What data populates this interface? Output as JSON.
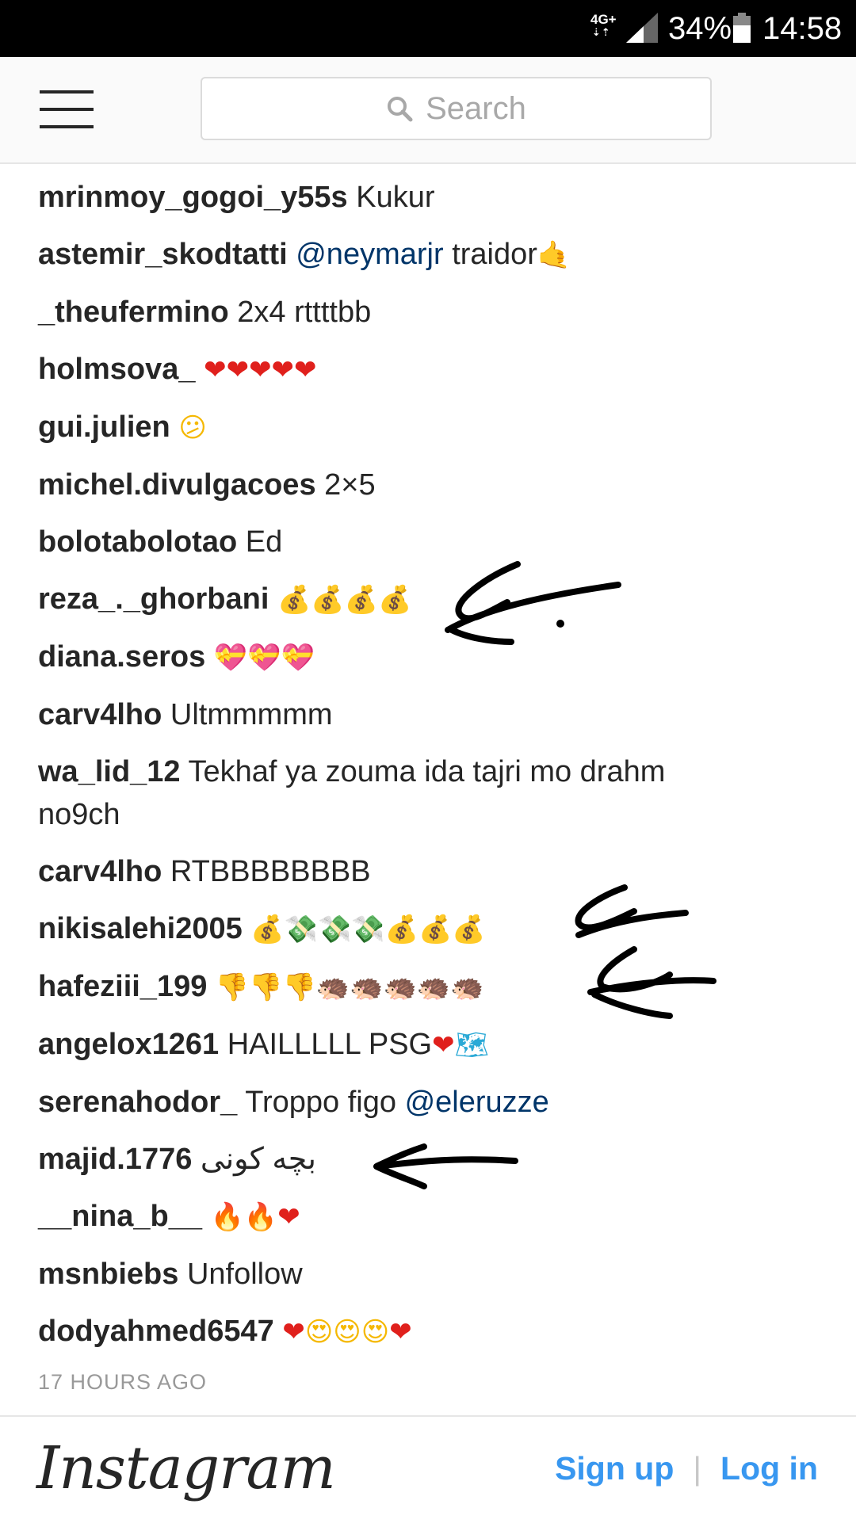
{
  "status_bar": {
    "network": "4G+",
    "battery": "34%",
    "time": "14:58"
  },
  "header": {
    "search_placeholder": "Search"
  },
  "comments": [
    {
      "user": "mrinmoy_gogoi_y55s",
      "text": "Kukur"
    },
    {
      "user": "astemir_skodtatti",
      "mention": "@neymarjr",
      "text": "traidor",
      "emojis": [
        "call-me-hand"
      ]
    },
    {
      "user": "_theufermino",
      "text": "2x4 rttttbb"
    },
    {
      "user": "holmsova_",
      "emojis": [
        "heart",
        "heart",
        "heart",
        "heart",
        "heart"
      ]
    },
    {
      "user": "gui.julien",
      "emojis": [
        "confused-face"
      ]
    },
    {
      "user": "michel.divulgacoes",
      "text": "2×5"
    },
    {
      "user": "bolotabolotao",
      "text": "Ed"
    },
    {
      "user": "reza_._ghorbani",
      "emojis": [
        "money-bag",
        "money-bag",
        "money-bag",
        "money-bag"
      ]
    },
    {
      "user": "diana.seros",
      "emojis": [
        "heart-ribbon",
        "heart-ribbon",
        "heart-ribbon"
      ]
    },
    {
      "user": "carv4lho",
      "text": "Ultmmmmm"
    },
    {
      "user": "wa_lid_12",
      "text": "Tekhaf ya zouma ida tajri mo drahm no9ch"
    },
    {
      "user": "carv4lho",
      "text": "RTBBBBBBBB"
    },
    {
      "user": "nikisalehi2005",
      "emojis": [
        "money-bag",
        "money-wings",
        "money-wings",
        "money-wings",
        "money-bag",
        "money-bag",
        "money-bag"
      ]
    },
    {
      "user": "hafeziii_199",
      "emojis": [
        "thumbs-down",
        "thumbs-down",
        "thumbs-down",
        "hedgehog",
        "hedgehog",
        "hedgehog",
        "hedgehog",
        "hedgehog"
      ]
    },
    {
      "user": "angelox1261",
      "text": "HAILLLLL PSG",
      "emojis": [
        "heart",
        "world-map"
      ]
    },
    {
      "user": "serenahodor_",
      "text": "Troppo figo",
      "mention": "@eleruzze"
    },
    {
      "user": "majid.1776",
      "text": "بچه کونی"
    },
    {
      "user": "__nina_b__",
      "emojis": [
        "fire",
        "fire",
        "heart"
      ]
    },
    {
      "user": "msnbiebs",
      "text": "Unfollow"
    },
    {
      "user": "dodyahmed6547",
      "emojis": [
        "heart",
        "heart-eyes",
        "heart-eyes",
        "heart-eyes",
        "heart"
      ]
    }
  ],
  "timestamp": "17 HOURS AGO",
  "footer": {
    "logo": "Instagram",
    "signup_label": "Sign up",
    "separator": "|",
    "login_label": "Log in"
  },
  "colors": {
    "link_blue": "#3897f0",
    "mention_blue": "#003569",
    "text": "#262626",
    "muted": "#999999"
  }
}
